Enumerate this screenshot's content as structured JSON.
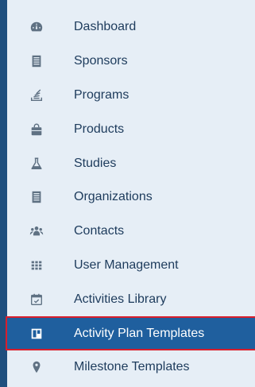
{
  "colors": {
    "sidebar_bg": "#1f4f7e",
    "panel_bg": "#e6eef6",
    "label_text": "#1d3b5c",
    "icon": "#5f7183",
    "active_bg": "#1f5f9e",
    "active_border": "#d81e2c",
    "active_text": "#ffffff"
  },
  "menu": {
    "items": [
      {
        "label": "Dashboard",
        "icon": "dashboard-icon"
      },
      {
        "label": "Sponsors",
        "icon": "building-icon"
      },
      {
        "label": "Programs",
        "icon": "stack-icon"
      },
      {
        "label": "Products",
        "icon": "shopping-bag-icon"
      },
      {
        "label": "Studies",
        "icon": "flask-icon"
      },
      {
        "label": "Organizations",
        "icon": "building-icon"
      },
      {
        "label": "Contacts",
        "icon": "users-icon"
      },
      {
        "label": "User Management",
        "icon": "grid-icon"
      },
      {
        "label": "Activities Library",
        "icon": "calendar-check-icon"
      },
      {
        "label": "Activity Plan Templates",
        "icon": "board-icon",
        "active": true
      },
      {
        "label": "Milestone Templates",
        "icon": "map-marker-icon"
      }
    ]
  }
}
